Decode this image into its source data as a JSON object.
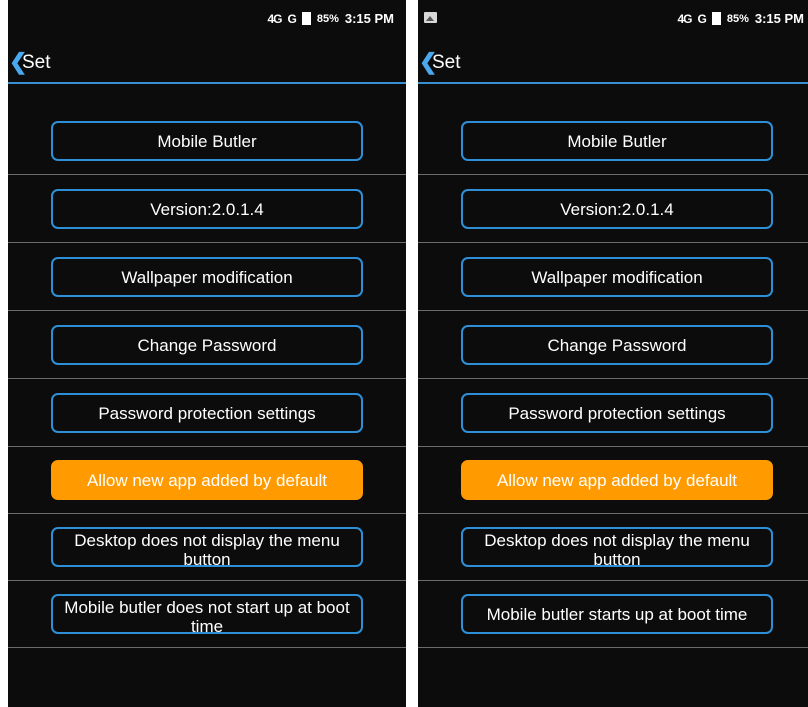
{
  "screens": [
    {
      "status": {
        "signal_4g": "4G",
        "signal_g": "G",
        "battery": "85%",
        "time": "3:15 PM",
        "notification_icon": ""
      },
      "title": "Set",
      "buttons": [
        {
          "label": "Mobile Butler"
        },
        {
          "label": "Version:2.0.1.4"
        },
        {
          "label": "Wallpaper modification"
        },
        {
          "label": "Change Password"
        },
        {
          "label": "Password protection settings"
        },
        {
          "label": "Allow new app added by default",
          "active": true
        },
        {
          "label": "Desktop does not display the menu button"
        },
        {
          "label": "Mobile butler does not start up at boot time"
        }
      ]
    },
    {
      "status": {
        "signal_4g": "4G",
        "signal_g": "G",
        "battery": "85%",
        "time": "3:15 PM",
        "notification_icon": "image-icon"
      },
      "title": "Set",
      "buttons": [
        {
          "label": "Mobile Butler"
        },
        {
          "label": "Version:2.0.1.4"
        },
        {
          "label": "Wallpaper modification"
        },
        {
          "label": "Change Password"
        },
        {
          "label": "Password protection settings"
        },
        {
          "label": "Allow new app added by default",
          "active": true
        },
        {
          "label": "Desktop does not display the menu button"
        },
        {
          "label": "Mobile butler starts up at boot time"
        }
      ]
    }
  ],
  "colors": {
    "accent": "#2f8fd6",
    "active": "#ff9a00",
    "background": "#0c0c0c"
  }
}
